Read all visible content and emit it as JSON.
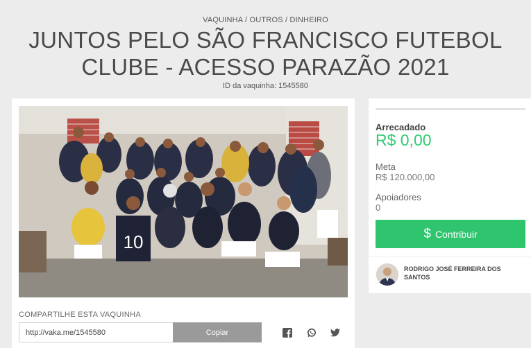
{
  "header": {
    "breadcrumb": "VAQUINHA / OUTROS / DINHEIRO",
    "title": "JUNTOS PELO SÃO FRANCISCO FUTEBOL CLUBE - ACESSO PARAZÃO 2021",
    "vaka_id": "ID da vaquinha: 1545580"
  },
  "photo": {
    "jersey_number": "10",
    "description_icon": "team-photo"
  },
  "share": {
    "label": "COMPARTILHE ESTA VAQUINHA",
    "link_value": "http://vaka.me/1545580",
    "copy_label": "Copiar",
    "icons": [
      "facebook-icon",
      "whatsapp-icon",
      "twitter-icon"
    ]
  },
  "stats": {
    "raised_label": "Arrecadado",
    "raised_value": "R$ 0,00",
    "goal_label": "Meta",
    "goal_value": "R$ 120.000,00",
    "supporters_label": "Apoiadores",
    "supporters_value": "0"
  },
  "contribute": {
    "icon": "$",
    "label": "Contribuir"
  },
  "organizer": {
    "name": "RODRIGO JOSÉ FERREIRA DOS SANTOS"
  },
  "colors": {
    "accent_green": "#2fc46e",
    "raised_green": "#2fcc71",
    "copy_gray": "#9a9a9a",
    "background": "#ececec"
  }
}
